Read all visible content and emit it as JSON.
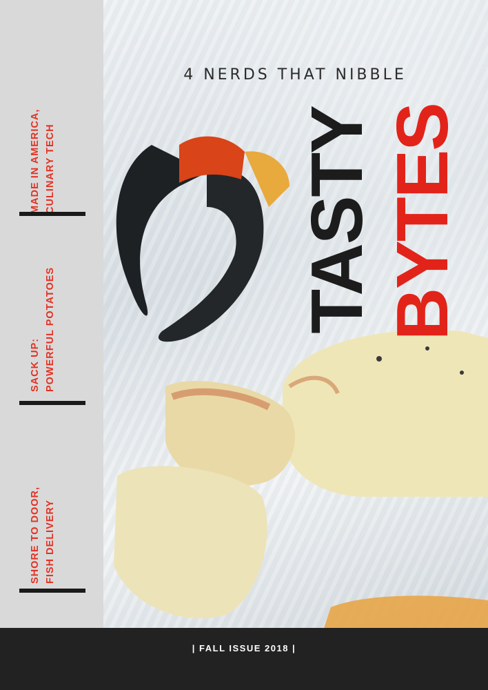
{
  "cover": {
    "headline": "4 NERDS THAT NIBBLE",
    "title_word_1": "TASTY",
    "title_word_2": "BYTES",
    "footer": "| FALL ISSUE 2018 |"
  },
  "sidebar": {
    "items": [
      {
        "label": "MADE IN AMERICA,\nCULINARY TECH"
      },
      {
        "label": "SACK UP:\nPOWERFUL POTATOES"
      },
      {
        "label": "SHORE TO DOOR,\nFISH DELIVERY"
      }
    ]
  },
  "colors": {
    "accent_red": "#e2231a",
    "sidebar_gray": "#d9d9d9",
    "footer_dark": "#222222"
  }
}
